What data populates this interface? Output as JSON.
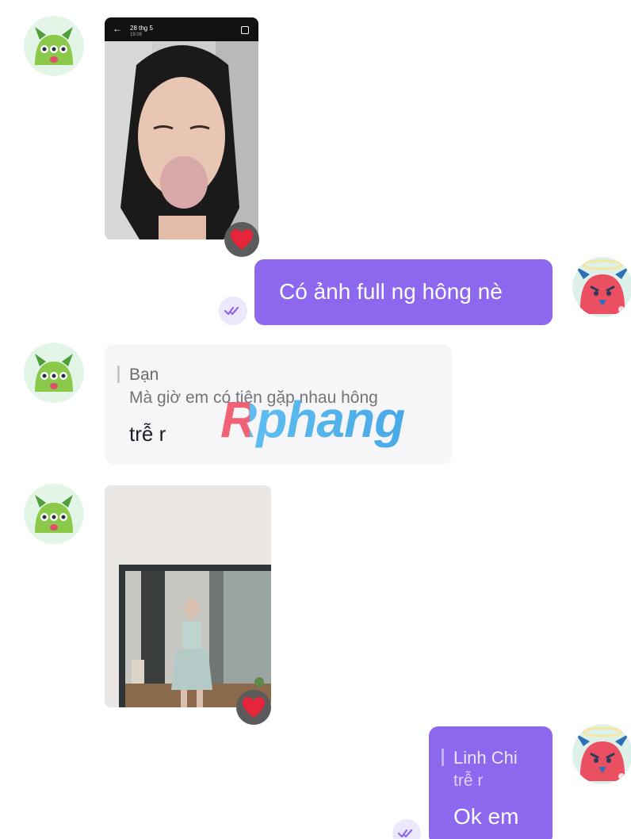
{
  "conversation": {
    "photo_1": {
      "top_bar": {
        "date": "28 thg 5",
        "time": "19:09"
      },
      "reaction": "heart"
    },
    "message_outgoing_1": {
      "text": "Có ảnh full ng hông nè",
      "status": "seen"
    },
    "message_incoming_reply": {
      "quoted_sender": "Bạn",
      "quoted_text": "Mà giờ em có tiện gặp nhau hông",
      "text": "trễ r"
    },
    "photo_2": {
      "reaction": "heart"
    },
    "message_outgoing_2": {
      "quoted_sender": "Linh Chi",
      "quoted_text": "trễ r",
      "text": "Ok em",
      "status": "seen"
    }
  },
  "watermark": {
    "text": "Rphang"
  },
  "colors": {
    "outgoing_bubble": "#8d67ee",
    "incoming_bubble": "#f6f6f8",
    "seen_badge": "#ece8fb",
    "heart": "#e5263a"
  },
  "icons": {
    "contact_avatar": "green-monster-avatar-icon",
    "self_avatar": "pink-devil-avatar-icon",
    "reaction": "heart-icon",
    "seen": "double-check-icon",
    "back": "arrow-left-icon",
    "scan": "scan-icon"
  }
}
